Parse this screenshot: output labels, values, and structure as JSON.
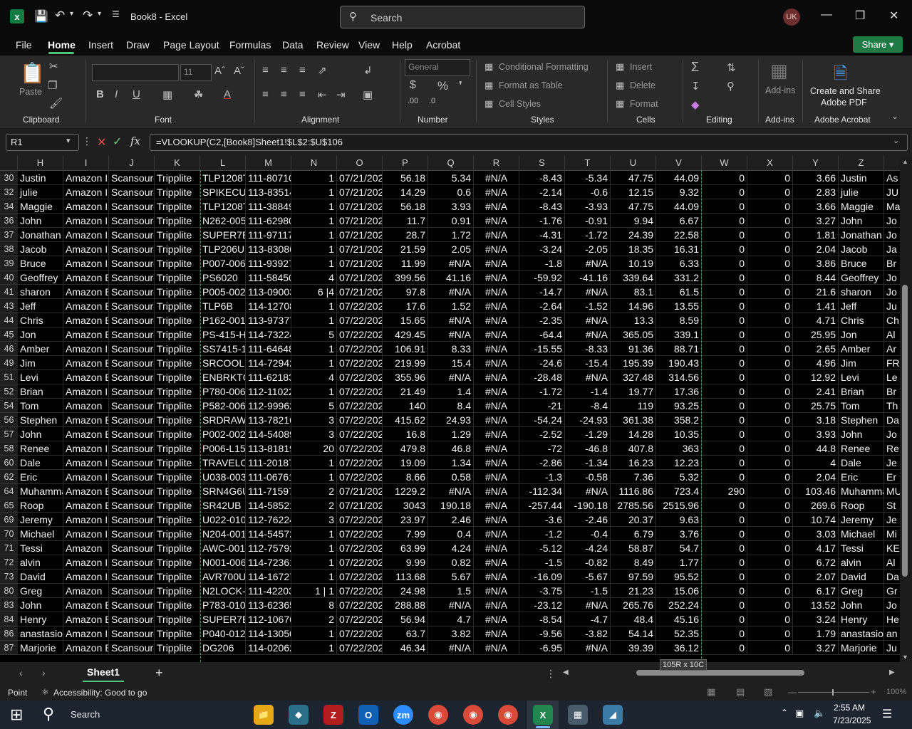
{
  "window": {
    "doc_title": "Book8  -  Excel",
    "search_placeholder": "Search",
    "user_initials": "UK"
  },
  "menu": {
    "items": [
      "File",
      "Home",
      "Insert",
      "Draw",
      "Page Layout",
      "Formulas",
      "Data",
      "Review",
      "View",
      "Help",
      "Acrobat"
    ],
    "active": "Home",
    "share_label": "Share"
  },
  "ribbon": {
    "clipboard": {
      "paste": "Paste",
      "label": "Clipboard"
    },
    "font": {
      "size": "11",
      "label": "Font"
    },
    "alignment": {
      "label": "Alignment"
    },
    "number": {
      "format": "General",
      "label": "Number"
    },
    "styles": {
      "conditional": "Conditional Formatting",
      "format_table": "Format as Table",
      "cell_styles": "Cell Styles",
      "label": "Styles"
    },
    "cells": {
      "insert": "Insert",
      "delete": "Delete",
      "format": "Format",
      "label": "Cells"
    },
    "editing": {
      "label": "Editing"
    },
    "addins": {
      "addins": "Add-ins",
      "label": "Add-ins"
    },
    "acrobat": {
      "create_line1": "Create and Share",
      "create_line2": "Adobe PDF",
      "label": "Adobe Acrobat"
    }
  },
  "formula_bar": {
    "name_box": "R1",
    "formula": "=VLOOKUP(C2,[Book8]Sheet1!$L$2:$U$106"
  },
  "columns": [
    "H",
    "I",
    "J",
    "K",
    "L",
    "M",
    "N",
    "O",
    "P",
    "Q",
    "R",
    "S",
    "T",
    "U",
    "V",
    "W",
    "X",
    "Y",
    "Z"
  ],
  "rows": [
    [
      "30",
      "Justin",
      "Amazon Ir",
      "Scansourc",
      "Tripplite",
      "TLP1208TE",
      "111-80710",
      "1",
      "07/21/202",
      "56.18",
      "5.34",
      "#N/A",
      "-8.43",
      "-5.34",
      "47.75",
      "44.09",
      "0",
      "0",
      "3.66",
      "Justin",
      "As"
    ],
    [
      "32",
      "julie",
      "Amazon Ir",
      "Scansourc",
      "Tripplite",
      "SPIKECUBI",
      "113-83514",
      "1",
      "07/21/202",
      "14.29",
      "0.6",
      "#N/A",
      "-2.14",
      "-0.6",
      "12.15",
      "9.32",
      "0",
      "0",
      "2.83",
      "julie",
      "JU"
    ],
    [
      "34",
      "Maggie",
      "Amazon Ir",
      "Scansourc",
      "Tripplite",
      "TLP1208TE",
      "111-38849",
      "1",
      "07/21/202",
      "56.18",
      "3.93",
      "#N/A",
      "-8.43",
      "-3.93",
      "47.75",
      "44.09",
      "0",
      "0",
      "3.66",
      "Maggie",
      "Ma"
    ],
    [
      "36",
      "John",
      "Amazon Ir",
      "Scansourc",
      "Tripplite",
      "N262-005-",
      "111-62980",
      "1",
      "07/21/202",
      "11.7",
      "0.91",
      "#N/A",
      "-1.76",
      "-0.91",
      "9.94",
      "6.67",
      "0",
      "0",
      "3.27",
      "John",
      "Jo"
    ],
    [
      "37",
      "Jonathan",
      "Amazon Ir",
      "Scansourc",
      "Tripplite",
      "SUPER7B",
      "111-97117",
      "1",
      "07/21/202",
      "28.7",
      "1.72",
      "#N/A",
      "-4.31",
      "-1.72",
      "24.39",
      "22.58",
      "0",
      "0",
      "1.81",
      "Jonathan",
      "Jo"
    ],
    [
      "38",
      "Jacob",
      "Amazon Ir",
      "Scansourc",
      "Tripplite",
      "TLP206USI",
      "113-83086",
      "1",
      "07/21/202",
      "21.59",
      "2.05",
      "#N/A",
      "-3.24",
      "-2.05",
      "18.35",
      "16.31",
      "0",
      "0",
      "2.04",
      "Jacob",
      "Ja"
    ],
    [
      "39",
      "Bruce",
      "Amazon Ir",
      "Scansourc",
      "Tripplite",
      "P007-006-",
      "111-93927",
      "1",
      "07/21/202",
      "11.99",
      "#N/A",
      "#N/A",
      "-1.8",
      "#N/A",
      "10.19",
      "6.33",
      "0",
      "0",
      "3.86",
      "Bruce",
      "Br"
    ],
    [
      "40",
      "Geoffrey",
      "Amazon B",
      "Scansourc",
      "Tripplite",
      "PS6020",
      "111-58450",
      "4",
      "07/21/202",
      "399.56",
      "41.16",
      "#N/A",
      "-59.92",
      "-41.16",
      "339.64",
      "331.2",
      "0",
      "0",
      "8.44",
      "Geoffrey",
      "Jo"
    ],
    [
      "41",
      "sharon",
      "Amazon B",
      "Scansourc",
      "Tripplite",
      "P005-002-",
      "113-09003",
      "6 |4",
      "07/21/202",
      "97.8",
      "#N/A",
      "#N/A",
      "-14.7",
      "#N/A",
      "83.1",
      "61.5",
      "0",
      "0",
      "21.6",
      "sharon",
      "Jo"
    ],
    [
      "43",
      "Jeff",
      "Amazon B",
      "Scansourc",
      "Tripplite",
      "TLP6B",
      "114-12708",
      "1",
      "07/22/202",
      "17.6",
      "1.52",
      "#N/A",
      "-2.64",
      "-1.52",
      "14.96",
      "13.55",
      "0",
      "0",
      "1.41",
      "Jeff",
      "Ju"
    ],
    [
      "44",
      "Chris",
      "Amazon B",
      "Scansourc",
      "Tripplite",
      "P162-001-",
      "113-97377",
      "1",
      "07/22/202",
      "15.65",
      "#N/A",
      "#N/A",
      "-2.35",
      "#N/A",
      "13.3",
      "8.59",
      "0",
      "0",
      "4.71",
      "Chris",
      "Ch"
    ],
    [
      "45",
      "Jon",
      "Amazon B",
      "Scansourc",
      "Tripplite",
      "PS-415-HG",
      "114-73224",
      "5",
      "07/22/202",
      "429.45",
      "#N/A",
      "#N/A",
      "-64.4",
      "#N/A",
      "365.05",
      "339.1",
      "0",
      "0",
      "25.95",
      "Jon",
      "Al"
    ],
    [
      "46",
      "Amber",
      "Amazon Ir",
      "Scansourc",
      "Tripplite",
      "SS7415-15",
      "111-64648",
      "1",
      "07/22/202",
      "106.91",
      "8.33",
      "#N/A",
      "-15.55",
      "-8.33",
      "91.36",
      "88.71",
      "0",
      "0",
      "2.65",
      "Amber",
      "Ar"
    ],
    [
      "49",
      "Jim",
      "Amazon B",
      "Scansourc",
      "Tripplite",
      "SRCOOL7K",
      "114-72942",
      "1",
      "07/22/202",
      "219.99",
      "15.4",
      "#N/A",
      "-24.6",
      "-15.4",
      "195.39",
      "190.43",
      "0",
      "0",
      "4.96",
      "Jim",
      "FR"
    ],
    [
      "51",
      "Levi",
      "Amazon B",
      "Scansourc",
      "Tripplite",
      "ENBRKTCV",
      "111-62183",
      "4",
      "07/22/202",
      "355.96",
      "#N/A",
      "#N/A",
      "-28.48",
      "#N/A",
      "327.48",
      "314.56",
      "0",
      "0",
      "12.92",
      "Levi",
      "Le"
    ],
    [
      "52",
      "Brian",
      "Amazon Ir",
      "Scansourc",
      "Tripplite",
      "P780-006",
      "112-11022",
      "1",
      "07/22/202",
      "21.49",
      "1.4",
      "#N/A",
      "-1.72",
      "-1.4",
      "19.77",
      "17.36",
      "0",
      "0",
      "2.41",
      "Brian",
      "Br"
    ],
    [
      "54",
      "Tom",
      "Amazon",
      "Scansourc",
      "Tripplite",
      "P582-006-",
      "112-99962",
      "5",
      "07/22/202",
      "140",
      "8.4",
      "#N/A",
      "-21",
      "-8.4",
      "119",
      "93.25",
      "0",
      "0",
      "25.75",
      "Tom",
      "Th"
    ],
    [
      "56",
      "Stephen",
      "Amazon B",
      "Scansourc",
      "Tripplite",
      "SRDRAWE",
      "113-78216",
      "3",
      "07/22/202",
      "415.62",
      "24.93",
      "#N/A",
      "-54.24",
      "-24.93",
      "361.38",
      "358.2",
      "0",
      "0",
      "3.18",
      "Stephen",
      "Da"
    ],
    [
      "57",
      "John",
      "Amazon B",
      "Scansourc",
      "Tripplite",
      "P002-002",
      "114-54089",
      "3",
      "07/22/202",
      "16.8",
      "1.29",
      "#N/A",
      "-2.52",
      "-1.29",
      "14.28",
      "10.35",
      "0",
      "0",
      "3.93",
      "John",
      "Jo"
    ],
    [
      "58",
      "Renee",
      "Amazon Ir",
      "Scansourc",
      "Tripplite",
      "P006-L15-",
      "113-81819",
      "20",
      "07/22/202",
      "479.8",
      "46.8",
      "#N/A",
      "-72",
      "-46.8",
      "407.8",
      "363",
      "0",
      "0",
      "44.8",
      "Renee",
      "Re"
    ],
    [
      "60",
      "Dale",
      "Amazon Ir",
      "Scansourc",
      "Tripplite",
      "TRAVELCU",
      "111-20187",
      "1",
      "07/22/202",
      "19.09",
      "1.34",
      "#N/A",
      "-2.86",
      "-1.34",
      "16.23",
      "12.23",
      "0",
      "0",
      "4",
      "Dale",
      "Je"
    ],
    [
      "62",
      "Eric",
      "Amazon Ir",
      "Scansourc",
      "Tripplite",
      "U038-003-",
      "111-06761",
      "1",
      "07/22/202",
      "8.66",
      "0.58",
      "#N/A",
      "-1.3",
      "-0.58",
      "7.36",
      "5.32",
      "0",
      "0",
      "2.04",
      "Eric",
      "Er"
    ],
    [
      "64",
      "Muhamma",
      "Amazon B",
      "Scansourc",
      "Tripplite",
      "SRN4G6U",
      "111-71597",
      "2",
      "07/21/202",
      "1229.2",
      "#N/A",
      "#N/A",
      "-112.34",
      "#N/A",
      "1116.86",
      "723.4",
      "290",
      "0",
      "103.46",
      "Muhamma",
      "MU"
    ],
    [
      "65",
      "Roop",
      "Amazon B",
      "Scansourc",
      "Tripplite",
      "SR42UB",
      "114-58521",
      "2",
      "07/21/202",
      "3043",
      "190.18",
      "#N/A",
      "-257.44",
      "-190.18",
      "2785.56",
      "2515.96",
      "0",
      "0",
      "269.6",
      "Roop",
      "St"
    ],
    [
      "69",
      "Jeremy",
      "Amazon Ir",
      "Scansourc",
      "Tripplite",
      "U022-010-",
      "112-76224",
      "3",
      "07/22/202",
      "23.97",
      "2.46",
      "#N/A",
      "-3.6",
      "-2.46",
      "20.37",
      "9.63",
      "0",
      "0",
      "10.74",
      "Jeremy",
      "Je"
    ],
    [
      "70",
      "Michael",
      "Amazon Ir",
      "Scansourc",
      "Tripplite",
      "N204-001-",
      "114-54572",
      "1",
      "07/22/202",
      "7.99",
      "0.4",
      "#N/A",
      "-1.2",
      "-0.4",
      "6.79",
      "3.76",
      "0",
      "0",
      "3.03",
      "Michael",
      "Mi"
    ],
    [
      "71",
      "Tessi",
      "Amazon",
      "Scansourc",
      "Tripplite",
      "AWC-001",
      "112-75792",
      "1",
      "07/22/202",
      "63.99",
      "4.24",
      "#N/A",
      "-5.12",
      "-4.24",
      "58.87",
      "54.7",
      "0",
      "0",
      "4.17",
      "Tessi",
      "KE"
    ],
    [
      "72",
      "alvin",
      "Amazon Ir",
      "Scansourc",
      "Tripplite",
      "N001-006-",
      "114-72361",
      "1",
      "07/22/202",
      "9.99",
      "0.82",
      "#N/A",
      "-1.5",
      "-0.82",
      "8.49",
      "1.77",
      "0",
      "0",
      "6.72",
      "alvin",
      "Al"
    ],
    [
      "73",
      "David",
      "Amazon Ir",
      "Scansourc",
      "Tripplite",
      "AVR700U",
      "114-16727",
      "1",
      "07/22/202",
      "113.68",
      "5.67",
      "#N/A",
      "-16.09",
      "-5.67",
      "97.59",
      "95.52",
      "0",
      "0",
      "2.07",
      "David",
      "Da"
    ],
    [
      "80",
      "Greg",
      "Amazon",
      "Scansourc",
      "Tripplite",
      "N2LOCK-0",
      "111-42203",
      "1 | 1",
      "07/22/202",
      "24.98",
      "1.5",
      "#N/A",
      "-3.75",
      "-1.5",
      "21.23",
      "15.06",
      "0",
      "0",
      "6.17",
      "Greg",
      "Gr"
    ],
    [
      "83",
      "John",
      "Amazon B",
      "Scansourc",
      "Tripplite",
      "P783-010",
      "113-62365",
      "8",
      "07/22/202",
      "288.88",
      "#N/A",
      "#N/A",
      "-23.12",
      "#N/A",
      "265.76",
      "252.24",
      "0",
      "0",
      "13.52",
      "John",
      "Jo"
    ],
    [
      "84",
      "Henry",
      "Amazon B",
      "Scansourc",
      "Tripplite",
      "SUPER7B",
      "112-10676",
      "2",
      "07/22/202",
      "56.94",
      "4.7",
      "#N/A",
      "-8.54",
      "-4.7",
      "48.4",
      "45.16",
      "0",
      "0",
      "3.24",
      "Henry",
      "He"
    ],
    [
      "86",
      "anastasios",
      "Amazon Ir",
      "Scansourc",
      "Tripplite",
      "P040-012-",
      "114-13050",
      "1",
      "07/22/202",
      "63.7",
      "3.82",
      "#N/A",
      "-9.56",
      "-3.82",
      "54.14",
      "52.35",
      "0",
      "0",
      "1.79",
      "anastasios",
      "an"
    ],
    [
      "87",
      "Marjorie",
      "Amazon B",
      "Scansourc",
      "Tripplite",
      "DG206",
      "114-02062",
      "1",
      "07/22/202",
      "46.34",
      "#N/A",
      "#N/A",
      "-6.95",
      "#N/A",
      "39.39",
      "36.12",
      "0",
      "0",
      "3.27",
      "Marjorie",
      "Ju"
    ]
  ],
  "sheet": {
    "tab": "Sheet1",
    "dimension_tip": "105R x 10C"
  },
  "status": {
    "mode": "Point",
    "accessibility": "Accessibility: Good to go",
    "zoom": "100%"
  },
  "taskbar": {
    "search": "Search",
    "time": "2:55 AM",
    "date": "7/23/2025"
  }
}
